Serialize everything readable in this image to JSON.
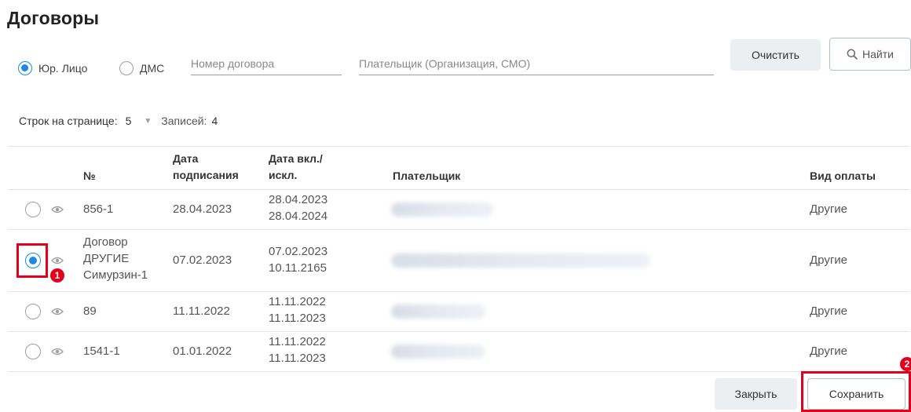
{
  "title": "Договоры",
  "filters": {
    "radio_legal": "Юр. Лицо",
    "radio_dms": "ДМС",
    "contract_placeholder": "Номер договора",
    "payer_placeholder": "Плательщик (Организация, СМО)",
    "clear_label": "Очистить",
    "find_label": "Найти"
  },
  "pager": {
    "rows_label": "Строк на странице:",
    "rows_value": "5",
    "records_label": "Записей:",
    "records_value": "4"
  },
  "table": {
    "headers": {
      "num": "№",
      "sign_line1": "Дата",
      "sign_line2": "подписания",
      "incl_line1": "Дата вкл./",
      "incl_line2": "искл.",
      "payer": "Плательщик",
      "payment": "Вид оплаты"
    },
    "rows": [
      {
        "num": [
          "856-1"
        ],
        "sign_date": "28.04.2023",
        "incl": "28.04.2023",
        "excl": "28.04.2024",
        "payment": "Другие",
        "selected": false
      },
      {
        "num": [
          "Договор",
          "ДРУГИЕ",
          "Симурзин-1"
        ],
        "sign_date": "07.02.2023",
        "incl": "07.02.2023",
        "excl": "10.11.2165",
        "payment": "Другие",
        "selected": true
      },
      {
        "num": [
          "89"
        ],
        "sign_date": "11.11.2022",
        "incl": "11.11.2022",
        "excl": "11.11.2023",
        "payment": "Другие",
        "selected": false
      },
      {
        "num": [
          "1541-1"
        ],
        "sign_date": "01.01.2022",
        "incl": "11.11.2022",
        "excl": "11.11.2023",
        "payment": "Другие",
        "selected": false
      }
    ]
  },
  "footer": {
    "close_label": "Закрыть",
    "save_label": "Сохранить"
  },
  "annotations": {
    "badge1": "1",
    "badge2": "2"
  },
  "colors": {
    "accent": "#1e88e5",
    "highlight": "#e2001a"
  }
}
